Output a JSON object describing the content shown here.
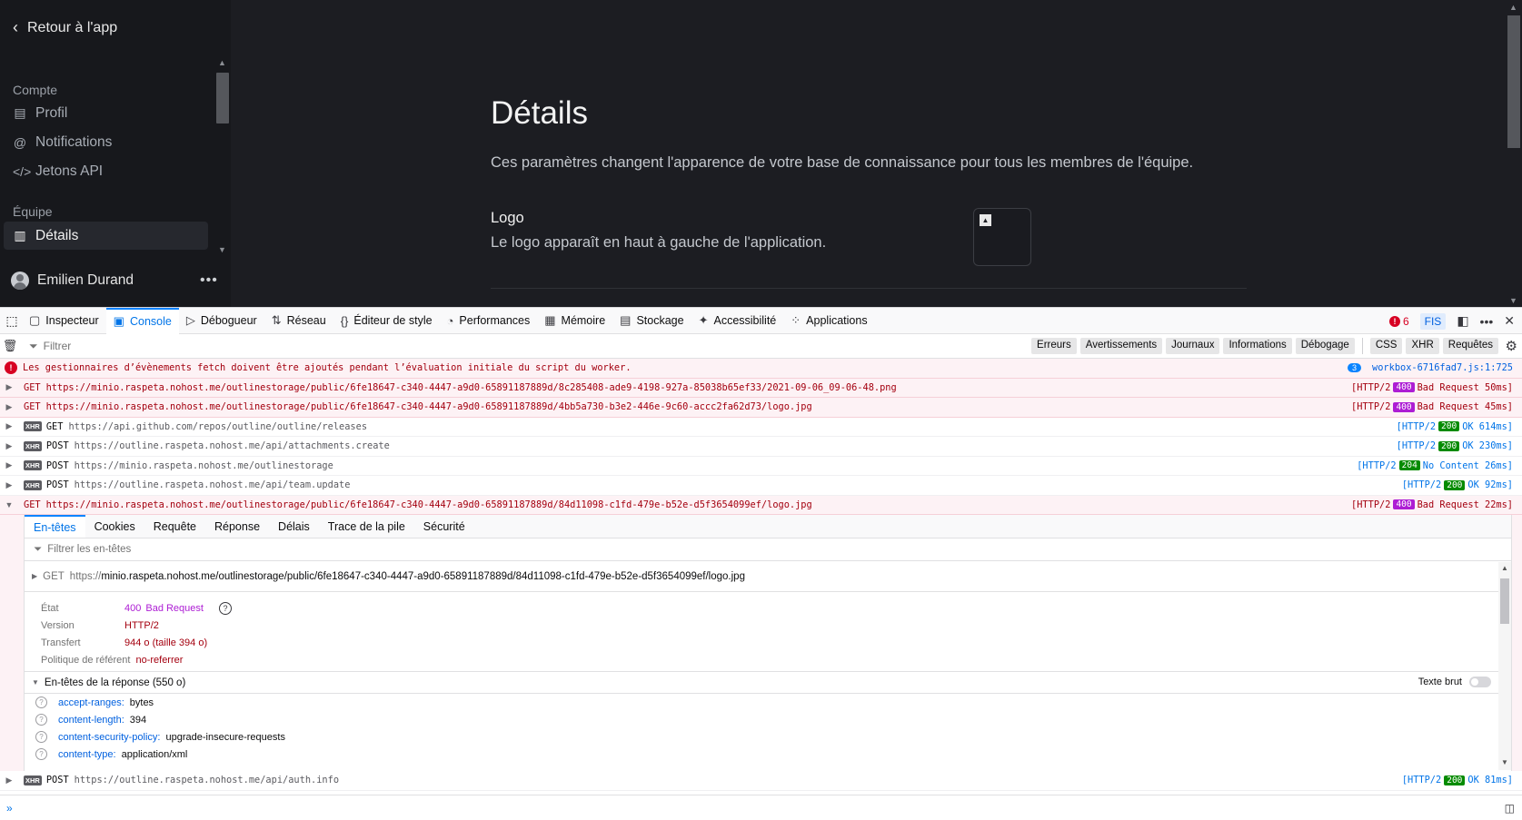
{
  "sidebar": {
    "back_label": "Retour à l'app",
    "section_account": "Compte",
    "items_account": [
      {
        "label": "Profil",
        "icon": "profile-card-icon"
      },
      {
        "label": "Notifications",
        "icon": "at-sign-icon"
      },
      {
        "label": "Jetons API",
        "icon": "code-icon"
      }
    ],
    "section_team": "Équipe",
    "items_team": [
      {
        "label": "Détails",
        "icon": "building-icon"
      }
    ],
    "user_name": "Emilien Durand"
  },
  "main": {
    "title": "Détails",
    "description": "Ces paramètres changent l'apparence de votre base de connaissance pour tous les membres de l'équipe.",
    "logo_label": "Logo",
    "logo_description": "Le logo apparaît en haut à gauche de l'application."
  },
  "devtools": {
    "tabs": [
      {
        "label": "Inspecteur",
        "icon": "{ }"
      },
      {
        "label": "Console"
      },
      {
        "label": "Débogueur"
      },
      {
        "label": "Réseau"
      },
      {
        "label": "Éditeur de style"
      },
      {
        "label": "Performances"
      },
      {
        "label": "Mémoire"
      },
      {
        "label": "Stockage"
      },
      {
        "label": "Accessibilité"
      },
      {
        "label": "Applications"
      }
    ],
    "error_count": "6",
    "locale": "FIS",
    "filter_placeholder": "Filtrer",
    "filter_buttons": [
      "Erreurs",
      "Avertissements",
      "Journaux",
      "Informations",
      "Débogage"
    ],
    "filter_buttons_2": [
      "CSS",
      "XHR",
      "Requêtes"
    ],
    "logs": {
      "error_message": "Les gestionnaires d’évènements fetch doivent être ajoutés pendant l’évaluation initiale du script du worker.",
      "error_repeat": "3",
      "error_source": "workbox-6716fad7.js:1:725",
      "rows": [
        {
          "method": "GET",
          "url": "https://minio.raspeta.nohost.me/outlinestorage/public/6fe18647-c340-4447-a9d0-65891187889d/8c285408-ade9-4198-927a-85038b65ef33/2021-09-06_09-06-48.png",
          "proto": "[HTTP/2",
          "code": "400",
          "text": "Bad Request 50ms]"
        },
        {
          "method": "GET",
          "url": "https://minio.raspeta.nohost.me/outlinestorage/public/6fe18647-c340-4447-a9d0-65891187889d/4bb5a730-b3e2-446e-9c60-accc2fa62d73/logo.jpg",
          "proto": "[HTTP/2",
          "code": "400",
          "text": "Bad Request 45ms]"
        },
        {
          "method": "GET",
          "url": "https://api.github.com/repos/outline/outline/releases",
          "proto": "[HTTP/2",
          "code": "200",
          "text": "OK 614ms]"
        },
        {
          "method": "POST",
          "url": "https://outline.raspeta.nohost.me/api/attachments.create",
          "proto": "[HTTP/2",
          "code": "200",
          "text": "OK 230ms]"
        },
        {
          "method": "POST",
          "url": "https://minio.raspeta.nohost.me/outlinestorage",
          "proto": "[HTTP/2",
          "code": "204",
          "text": "No Content 26ms]"
        },
        {
          "method": "POST",
          "url": "https://outline.raspeta.nohost.me/api/team.update",
          "proto": "[HTTP/2",
          "code": "200",
          "text": "OK 92ms]"
        },
        {
          "method": "GET",
          "url": "https://minio.raspeta.nohost.me/outlinestorage/public/6fe18647-c340-4447-a9d0-65891187889d/84d11098-c1fd-479e-b52e-d5f3654099ef/logo.jpg",
          "proto": "[HTTP/2",
          "code": "400",
          "text": "Bad Request 22ms]"
        },
        {
          "method": "POST",
          "url": "https://outline.raspeta.nohost.me/api/auth.info",
          "proto": "[HTTP/2",
          "code": "200",
          "text": "OK 81ms]"
        }
      ]
    },
    "panel": {
      "tabs": [
        "En-têtes",
        "Cookies",
        "Requête",
        "Réponse",
        "Délais",
        "Trace de la pile",
        "Sécurité"
      ],
      "filter_placeholder": "Filtrer les en-têtes",
      "request_method": "GET",
      "request_scheme": "https://",
      "request_rest": "minio.raspeta.nohost.me/outlinestorage/public/6fe18647-c340-4447-a9d0-65891187889d/84d11098-c1fd-479e-b52e-d5f3654099ef/logo.jpg",
      "summary": {
        "state_label": "État",
        "state_code": "400",
        "state_text": "Bad Request",
        "version_label": "Version",
        "version_value": "HTTP/2",
        "transfer_label": "Transfert",
        "transfer_value": "944 o (taille 394 o)",
        "referrer_label": "Politique de référent",
        "referrer_value": "no-referrer"
      },
      "response_headers_title": "En-têtes de la réponse (550 o)",
      "raw_toggle_label": "Texte brut",
      "headers": [
        {
          "name": "accept-ranges:",
          "value": "bytes"
        },
        {
          "name": "content-length:",
          "value": "394"
        },
        {
          "name": "content-security-policy:",
          "value": "upgrade-insecure-requests"
        },
        {
          "name": "content-type:",
          "value": "application/xml"
        }
      ]
    },
    "prompt": "»"
  }
}
